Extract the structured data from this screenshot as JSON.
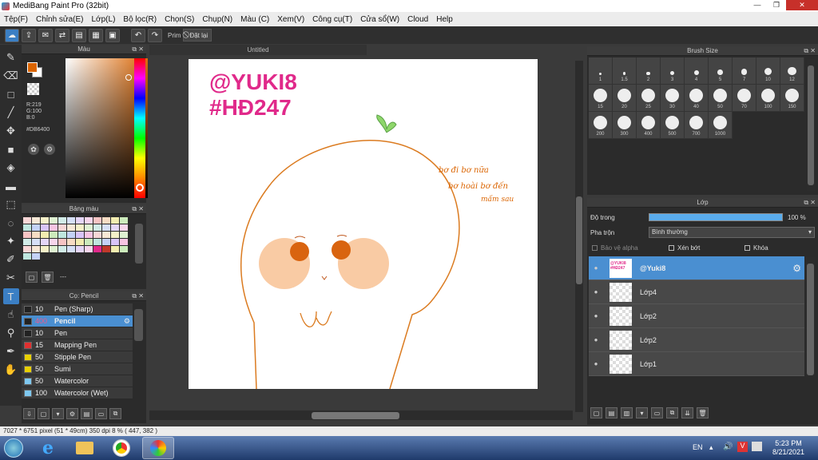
{
  "window": {
    "title": "MediBang Paint Pro (32bit)"
  },
  "menu": [
    "Tệp(F)",
    "Chỉnh sửa(E)",
    "Lớp(L)",
    "Bộ lọc(R)",
    "Chọn(S)",
    "Chụp(N)",
    "Màu (C)",
    "Xem(V)",
    "Công cụ(T)",
    "Cửa sổ(W)",
    "Cloud",
    "Help"
  ],
  "toolbar": {
    "prim_label": "Prim",
    "reset_label": "Đặt lại"
  },
  "color_panel": {
    "title": "Màu",
    "r": "R:219",
    "g": "G:100",
    "b": "B:0",
    "hex": "#DB6400",
    "fg": "#DB6400",
    "bg": "#ffffff"
  },
  "palette": {
    "title": "Bảng màu",
    "footer": "---"
  },
  "brush_list": {
    "title": "Cọ: Pencil",
    "items": [
      {
        "size": "10",
        "name": "Pen (Sharp)",
        "color": "#222222"
      },
      {
        "size": "400",
        "name": "Pencil",
        "color": "#222222"
      },
      {
        "size": "10",
        "name": "Pen",
        "color": "#222222"
      },
      {
        "size": "15",
        "name": "Mapping Pen",
        "color": "#e03030"
      },
      {
        "size": "50",
        "name": "Stipple Pen",
        "color": "#e8d000"
      },
      {
        "size": "50",
        "name": "Sumi",
        "color": "#e8d000"
      },
      {
        "size": "50",
        "name": "Watercolor",
        "color": "#7ec8f0"
      },
      {
        "size": "100",
        "name": "Watercolor (Wet)",
        "color": "#7ec8f0"
      }
    ]
  },
  "canvas": {
    "tab_title": "Untitled",
    "text_line1": "@YUKI8",
    "text_line2": "#HĐ247",
    "note_line1": "bơ đi bơ nữa",
    "note_line2": "bơ hoài   bơ đến",
    "note_line3": "mấm sau"
  },
  "brush_size": {
    "title": "Brush Size",
    "row1": [
      "1",
      "1.5",
      "2",
      "3",
      "4",
      "5",
      "7",
      "10",
      "12"
    ],
    "row2": [
      "15",
      "20",
      "25",
      "30",
      "40",
      "50",
      "70",
      "100",
      "150"
    ],
    "row3": [
      "200",
      "300",
      "400",
      "500",
      "700",
      "1000"
    ]
  },
  "layers": {
    "title": "Lớp",
    "opacity_label": "Độ trong",
    "opacity_value": "100 %",
    "blend_label": "Pha trộn",
    "blend_value": "Bình thường",
    "protect_alpha": "Bảo vệ alpha",
    "clipping": "Xén bớt",
    "lock": "Khóa",
    "items": [
      "@Yuki8",
      "Lớp4",
      "Lớp2",
      "Lớp2",
      "Lớp1"
    ],
    "thumb_text": "@YUKI8 #HĐ247"
  },
  "status": {
    "text": "7027 * 6751 pixel   (51 * 49cm)   350 dpi   8 %   ( 447, 382 )"
  },
  "taskbar": {
    "lang": "EN",
    "time": "5:23 PM",
    "date": "8/21/2021"
  }
}
